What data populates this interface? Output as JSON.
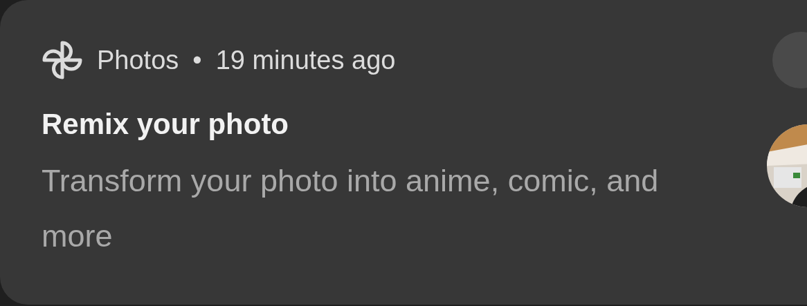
{
  "notification": {
    "app_name": "Photos",
    "separator": "•",
    "time": "19 minutes ago",
    "title": "Remix your photo",
    "body": "Transform your photo into anime, comic, and more"
  }
}
